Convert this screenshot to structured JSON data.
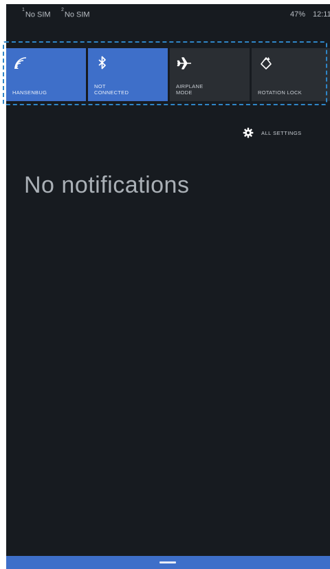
{
  "status_bar": {
    "sim1_slot": "1",
    "sim1_text": "No SIM",
    "sim2_slot": "2",
    "sim2_text": "No SIM",
    "battery": "47%",
    "time": "12:11"
  },
  "quick_actions": [
    {
      "label": "HANSENBUG",
      "icon": "wifi-icon",
      "state": "on"
    },
    {
      "label": "NOT\nCONNECTED",
      "icon": "bluetooth-icon",
      "state": "on"
    },
    {
      "label": "AIRPLANE\nMODE",
      "icon": "airplane-icon",
      "state": "off"
    },
    {
      "label": "ROTATION LOCK",
      "icon": "rotation-lock-icon",
      "state": "off"
    }
  ],
  "all_settings": {
    "label": "ALL SETTINGS",
    "icon": "gear-icon"
  },
  "notifications": {
    "empty_text": "No notifications"
  },
  "colors": {
    "accent": "#3e6fc9",
    "background": "#171b20",
    "tile_off": "#2a2e33",
    "highlight_frame": "#2f86c8"
  }
}
